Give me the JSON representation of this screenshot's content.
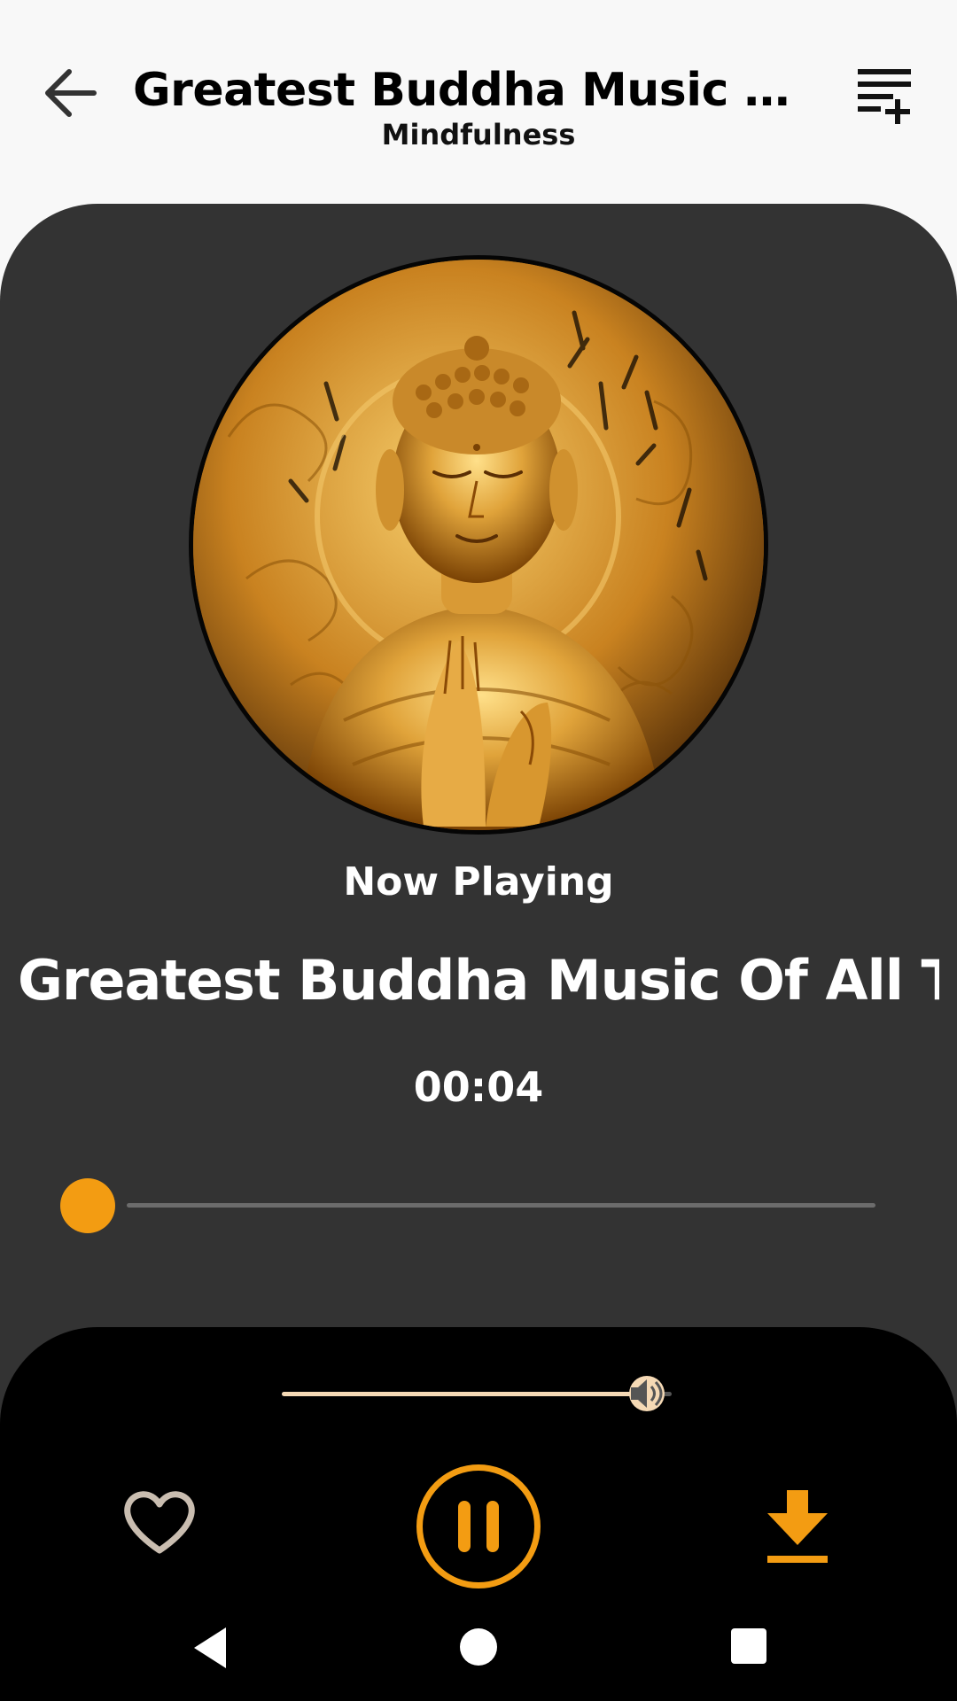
{
  "header": {
    "title": "Greatest Buddha Music Of...",
    "subtitle": "Mindfulness",
    "back_icon": "arrow-left-icon",
    "queue_icon": "playlist-add-icon"
  },
  "player": {
    "artwork_icon": "buddha-statue-artwork",
    "now_playing_label": "Now Playing",
    "track_title": "Greatest Buddha Music Of All Ti..",
    "elapsed_time": "00:04",
    "progress_fraction": 0.0,
    "volume_fraction": 0.92
  },
  "controls": {
    "favorite_icon": "heart-outline-icon",
    "play_pause_icon": "pause-icon",
    "download_icon": "download-icon",
    "volume_icon": "volume-icon"
  },
  "system_nav": {
    "back_icon": "nav-back-icon",
    "home_icon": "nav-home-icon",
    "recents_icon": "nav-recents-icon"
  },
  "colors": {
    "accent": "#f39c12",
    "card_background": "#333333",
    "controls_background": "#000000",
    "page_background": "#f8f8f8"
  }
}
